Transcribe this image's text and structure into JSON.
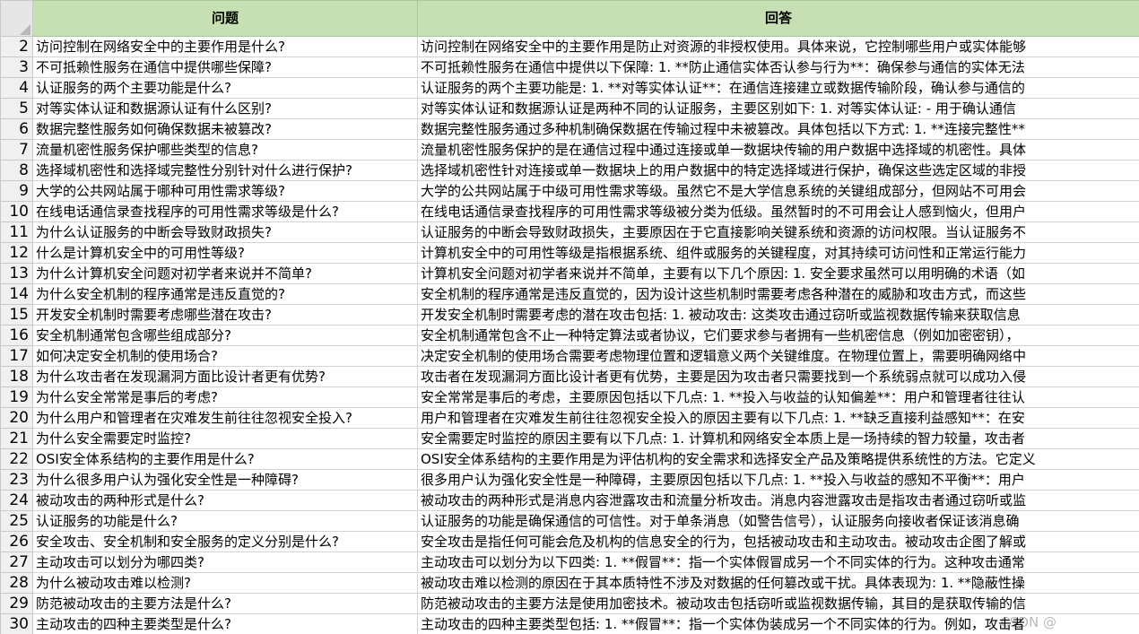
{
  "header": {
    "question": "问题",
    "answer": "回答"
  },
  "rows": [
    {
      "n": "2",
      "q": "访问控制在网络安全中的主要作用是什么?",
      "a": "访问控制在网络安全中的主要作用是防止对资源的非授权使用。具体来说，它控制哪些用户或实体能够"
    },
    {
      "n": "3",
      "q": "不可抵赖性服务在通信中提供哪些保障?",
      "a": "不可抵赖性服务在通信中提供以下保障:   1. **防止通信实体否认参与行为**：确保参与通信的实体无法"
    },
    {
      "n": "4",
      "q": "认证服务的两个主要功能是什么?",
      "a": "认证服务的两个主要功能是:   1. **对等实体认证**：在通信连接建立或数据传输阶段，确认参与通信的"
    },
    {
      "n": "5",
      "q": "对等实体认证和数据源认证有什么区别?",
      "a": "对等实体认证和数据源认证是两种不同的认证服务，主要区别如下: 1. 对等实体认证: - 用于确认通信"
    },
    {
      "n": "6",
      "q": "数据完整性服务如何确保数据未被篡改?",
      "a": "数据完整性服务通过多种机制确保数据在传输过程中未被篡改。具体包括以下方式: 1. **连接完整性**"
    },
    {
      "n": "7",
      "q": "流量机密性服务保护哪些类型的信息?",
      "a": "流量机密性服务保护的是在通信过程中通过连接或单一数据块传输的用户数据中选择域的机密性。具体"
    },
    {
      "n": "8",
      "q": "选择域机密性和选择域完整性分别针对什么进行保护?",
      "a": "选择域机密性针对连接或单一数据块上的用户数据中的特定选择域进行保护，确保这些选定区域的非授"
    },
    {
      "n": "9",
      "q": "大学的公共网站属于哪种可用性需求等级?",
      "a": "大学的公共网站属于中级可用性需求等级。虽然它不是大学信息系统的关键组成部分，但网站不可用会"
    },
    {
      "n": "10",
      "q": "在线电话通信录查找程序的可用性需求等级是什么?",
      "a": "在线电话通信录查找程序的可用性需求等级被分类为低级。虽然暂时的不可用会让人感到恼火，但用户"
    },
    {
      "n": "11",
      "q": "为什么认证服务的中断会导致财政损失?",
      "a": "认证服务的中断会导致财政损失，主要原因在于它直接影响关键系统和资源的访问权限。当认证服务不"
    },
    {
      "n": "12",
      "q": "什么是计算机安全中的可用性等级?",
      "a": "计算机安全中的可用性等级是指根据系统、组件或服务的关键程度，对其持续可访问性和正常运行能力"
    },
    {
      "n": "13",
      "q": "为什么计算机安全问题对初学者来说并不简单?",
      "a": "计算机安全问题对初学者来说并不简单，主要有以下几个原因: 1. 安全要求虽然可以用明确的术语（如"
    },
    {
      "n": "14",
      "q": "为什么安全机制的程序通常是违反直觉的?",
      "a": "安全机制的程序通常是违反直觉的，因为设计这些机制时需要考虑各种潜在的威胁和攻击方式，而这些"
    },
    {
      "n": "15",
      "q": "开发安全机制时需要考虑哪些潜在攻击?",
      "a": "开发安全机制时需要考虑的潜在攻击包括: 1. 被动攻击: 这类攻击通过窃听或监视数据传输来获取信息"
    },
    {
      "n": "16",
      "q": "安全机制通常包含哪些组成部分?",
      "a": "安全机制通常包含不止一种特定算法或者协议，它们要求参与者拥有一些机密信息（例如加密密钥），"
    },
    {
      "n": "17",
      "q": "如何决定安全机制的使用场合?",
      "a": "决定安全机制的使用场合需要考虑物理位置和逻辑意义两个关键维度。在物理位置上，需要明确网络中"
    },
    {
      "n": "18",
      "q": "为什么攻击者在发现漏洞方面比设计者更有优势?",
      "a": "攻击者在发现漏洞方面比设计者更有优势，主要是因为攻击者只需要找到一个系统弱点就可以成功入侵"
    },
    {
      "n": "19",
      "q": "为什么安全常常是事后的考虑?",
      "a": "安全常常是事后的考虑，主要原因包括以下几点: 1. **投入与收益的认知偏差**：用户和管理者往往认"
    },
    {
      "n": "20",
      "q": "为什么用户和管理者在灾难发生前往往忽视安全投入?",
      "a": "用户和管理者在灾难发生前往往忽视安全投入的原因主要有以下几点: 1. **缺乏直接利益感知**：在安"
    },
    {
      "n": "21",
      "q": "为什么安全需要定时监控?",
      "a": "安全需要定时监控的原因主要有以下几点: 1. 计算机和网络安全本质上是一场持续的智力较量，攻击者"
    },
    {
      "n": "22",
      "q": "OSI安全体系结构的主要作用是什么?",
      "a": "OSI安全体系结构的主要作用是为评估机构的安全需求和选择安全产品及策略提供系统性的方法。它定义"
    },
    {
      "n": "23",
      "q": "为什么很多用户认为强化安全性是一种障碍?",
      "a": "很多用户认为强化安全性是一种障碍，主要原因包括以下几点: 1. **投入与收益的感知不平衡**：用户"
    },
    {
      "n": "24",
      "q": "被动攻击的两种形式是什么?",
      "a": "被动攻击的两种形式是消息内容泄露攻击和流量分析攻击。消息内容泄露攻击是指攻击者通过窃听或监"
    },
    {
      "n": "25",
      "q": "认证服务的功能是什么?",
      "a": "认证服务的功能是确保通信的可信性。对于单条消息（如警告信号），认证服务向接收者保证该消息确"
    },
    {
      "n": "26",
      "q": "安全攻击、安全机制和安全服务的定义分别是什么?",
      "a": "安全攻击是指任何可能会危及机构的信息安全的行为，包括被动攻击和主动攻击。被动攻击企图了解或"
    },
    {
      "n": "27",
      "q": "主动攻击可以划分为哪四类?",
      "a": "主动攻击可以划分为以下四类: 1. **假冒**：指一个实体假冒成另一个不同实体的行为。这种攻击通常"
    },
    {
      "n": "28",
      "q": "为什么被动攻击难以检测?",
      "a": "被动攻击难以检测的原因在于其本质特性不涉及对数据的任何篡改或干扰。具体表现为: 1. **隐蔽性操"
    },
    {
      "n": "29",
      "q": "防范被动攻击的主要方法是什么?",
      "a": "防范被动攻击的主要方法是使用加密技术。被动攻击包括窃听或监视数据传输，其目的是获取传输的信"
    },
    {
      "n": "30",
      "q": "主动攻击的四种主要类型是什么?",
      "a": "主动攻击的四种主要类型包括: 1. **假冒**：指一个实体伪装成另一个不同实体的行为。例如，攻击者"
    }
  ]
}
